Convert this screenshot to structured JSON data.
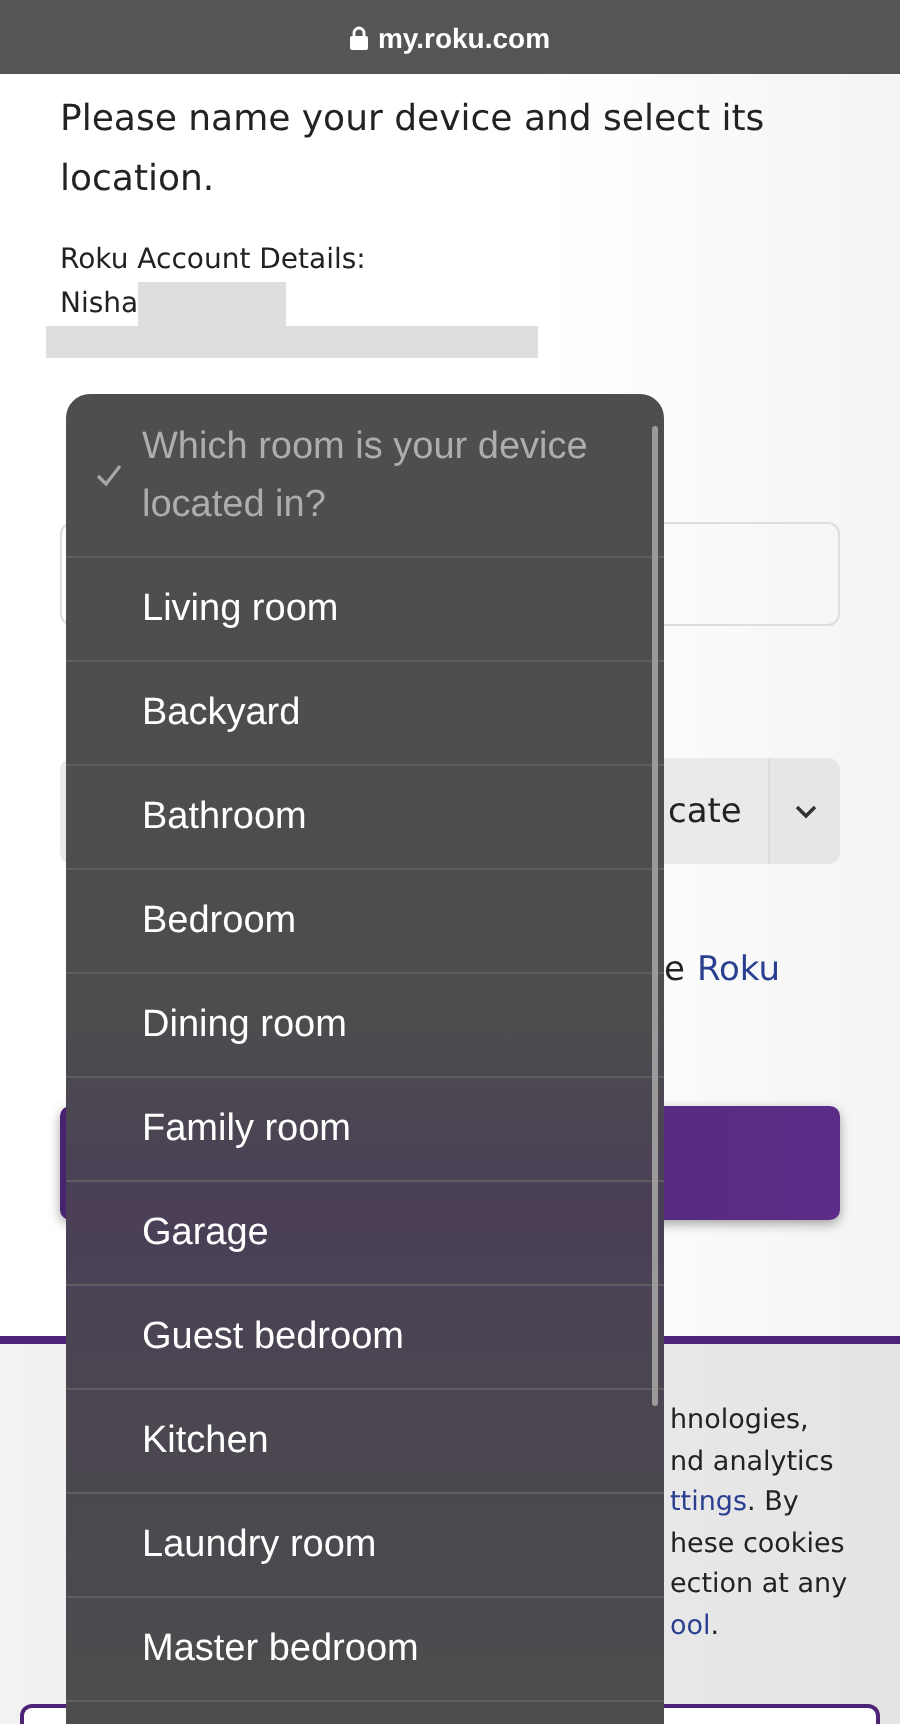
{
  "address_bar": {
    "url": "my.roku.com",
    "secure": true
  },
  "form": {
    "heading": "Please name your device and select its location.",
    "account_label": "Roku Account Details:",
    "account_name": "Nisha",
    "location_select_fragment": "cate",
    "consent_fragment": "e",
    "consent_link": "Roku"
  },
  "cookie_notice": {
    "lines": [
      [
        {
          "text": "hnologies,",
          "link": false
        }
      ],
      [
        {
          "text": "nd analytics",
          "link": false
        }
      ],
      [
        {
          "text": "ttings",
          "link": true
        },
        {
          "text": ". By",
          "link": false
        }
      ],
      [
        {
          "text": "hese cookies",
          "link": false
        }
      ],
      [
        {
          "text": "ection at any",
          "link": false
        }
      ],
      [
        {
          "text": "ool",
          "link": true
        },
        {
          "text": ".",
          "link": false
        }
      ]
    ]
  },
  "room_menu": {
    "items": [
      {
        "label": "Which room is your device located in?",
        "kind": "placeholder",
        "selected": true
      },
      {
        "label": "Living room",
        "kind": "option",
        "selected": false
      },
      {
        "label": "Backyard",
        "kind": "option",
        "selected": false
      },
      {
        "label": "Bathroom",
        "kind": "option",
        "selected": false
      },
      {
        "label": "Bedroom",
        "kind": "option",
        "selected": false
      },
      {
        "label": "Dining room",
        "kind": "option",
        "selected": false
      },
      {
        "label": "Family room",
        "kind": "option",
        "selected": false
      },
      {
        "label": "Garage",
        "kind": "option",
        "selected": false
      },
      {
        "label": "Guest bedroom",
        "kind": "option",
        "selected": false
      },
      {
        "label": "Kitchen",
        "kind": "option",
        "selected": false
      },
      {
        "label": "Laundry room",
        "kind": "option",
        "selected": false
      },
      {
        "label": "Master bedroom",
        "kind": "option",
        "selected": false
      }
    ]
  }
}
